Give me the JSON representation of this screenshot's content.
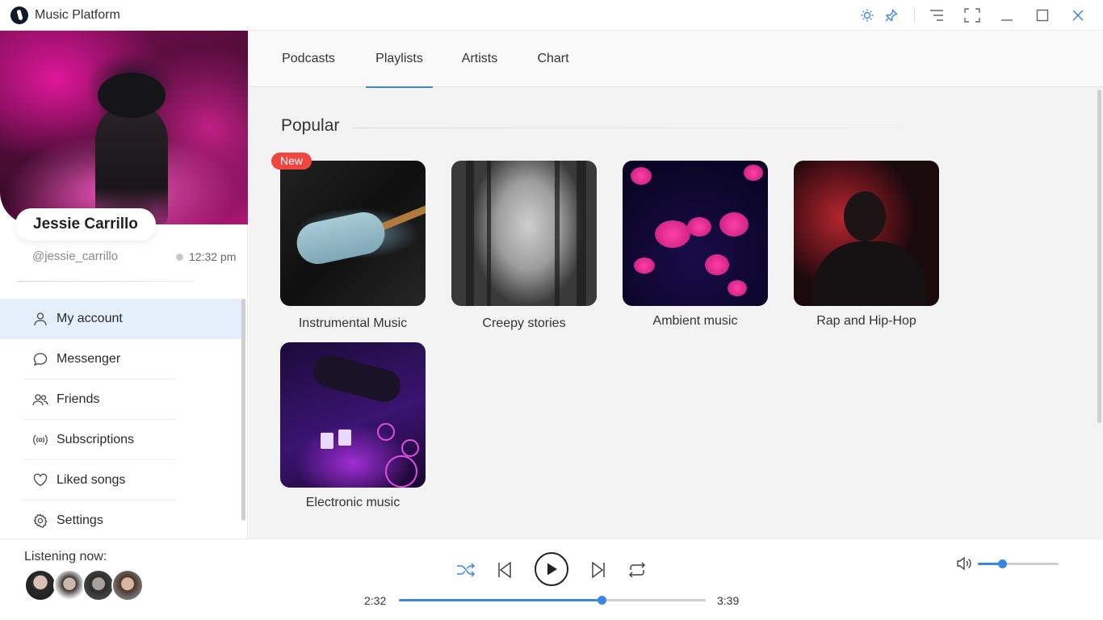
{
  "app": {
    "title": "Music Platform"
  },
  "titlebar": {
    "icons": [
      "sun-icon",
      "pin-icon",
      "menu-lines-icon",
      "fullscreen-icon",
      "minimize-icon",
      "maximize-icon",
      "close-icon"
    ],
    "accent": "#3b86e0"
  },
  "profile": {
    "name": "Jessie Carrillo",
    "handle": "@jessie_carrillo",
    "time": "12:32 pm"
  },
  "sidebar": {
    "items": [
      {
        "label": "My account",
        "icon": "user-icon",
        "active": true
      },
      {
        "label": "Messenger",
        "icon": "chat-bubble-icon",
        "active": false
      },
      {
        "label": "Friends",
        "icon": "friends-icon",
        "active": false
      },
      {
        "label": "Subscriptions",
        "icon": "broadcast-icon",
        "active": false
      },
      {
        "label": "Liked songs",
        "icon": "heart-icon",
        "active": false
      },
      {
        "label": "Settings",
        "icon": "gear-icon",
        "active": false
      }
    ]
  },
  "tabs": [
    {
      "label": "Podcasts",
      "active": false
    },
    {
      "label": "Playlists",
      "active": true
    },
    {
      "label": "Artists",
      "active": false
    },
    {
      "label": "Chart",
      "active": false
    }
  ],
  "section": {
    "title": "Popular"
  },
  "playlists": [
    {
      "title": "Instrumental Music",
      "badge": "New"
    },
    {
      "title": "Creepy stories"
    },
    {
      "title": "Ambient music"
    },
    {
      "title": "Rap and Hip-Hop"
    },
    {
      "title": "Electronic music"
    }
  ],
  "player": {
    "listening_label": "Listening now:",
    "elapsed": "2:32",
    "total": "3:39",
    "progress": 0.66,
    "volume": 0.3,
    "controls": [
      "shuffle-icon",
      "previous-icon",
      "play-icon",
      "next-icon",
      "repeat-icon",
      "volume-icon"
    ]
  }
}
